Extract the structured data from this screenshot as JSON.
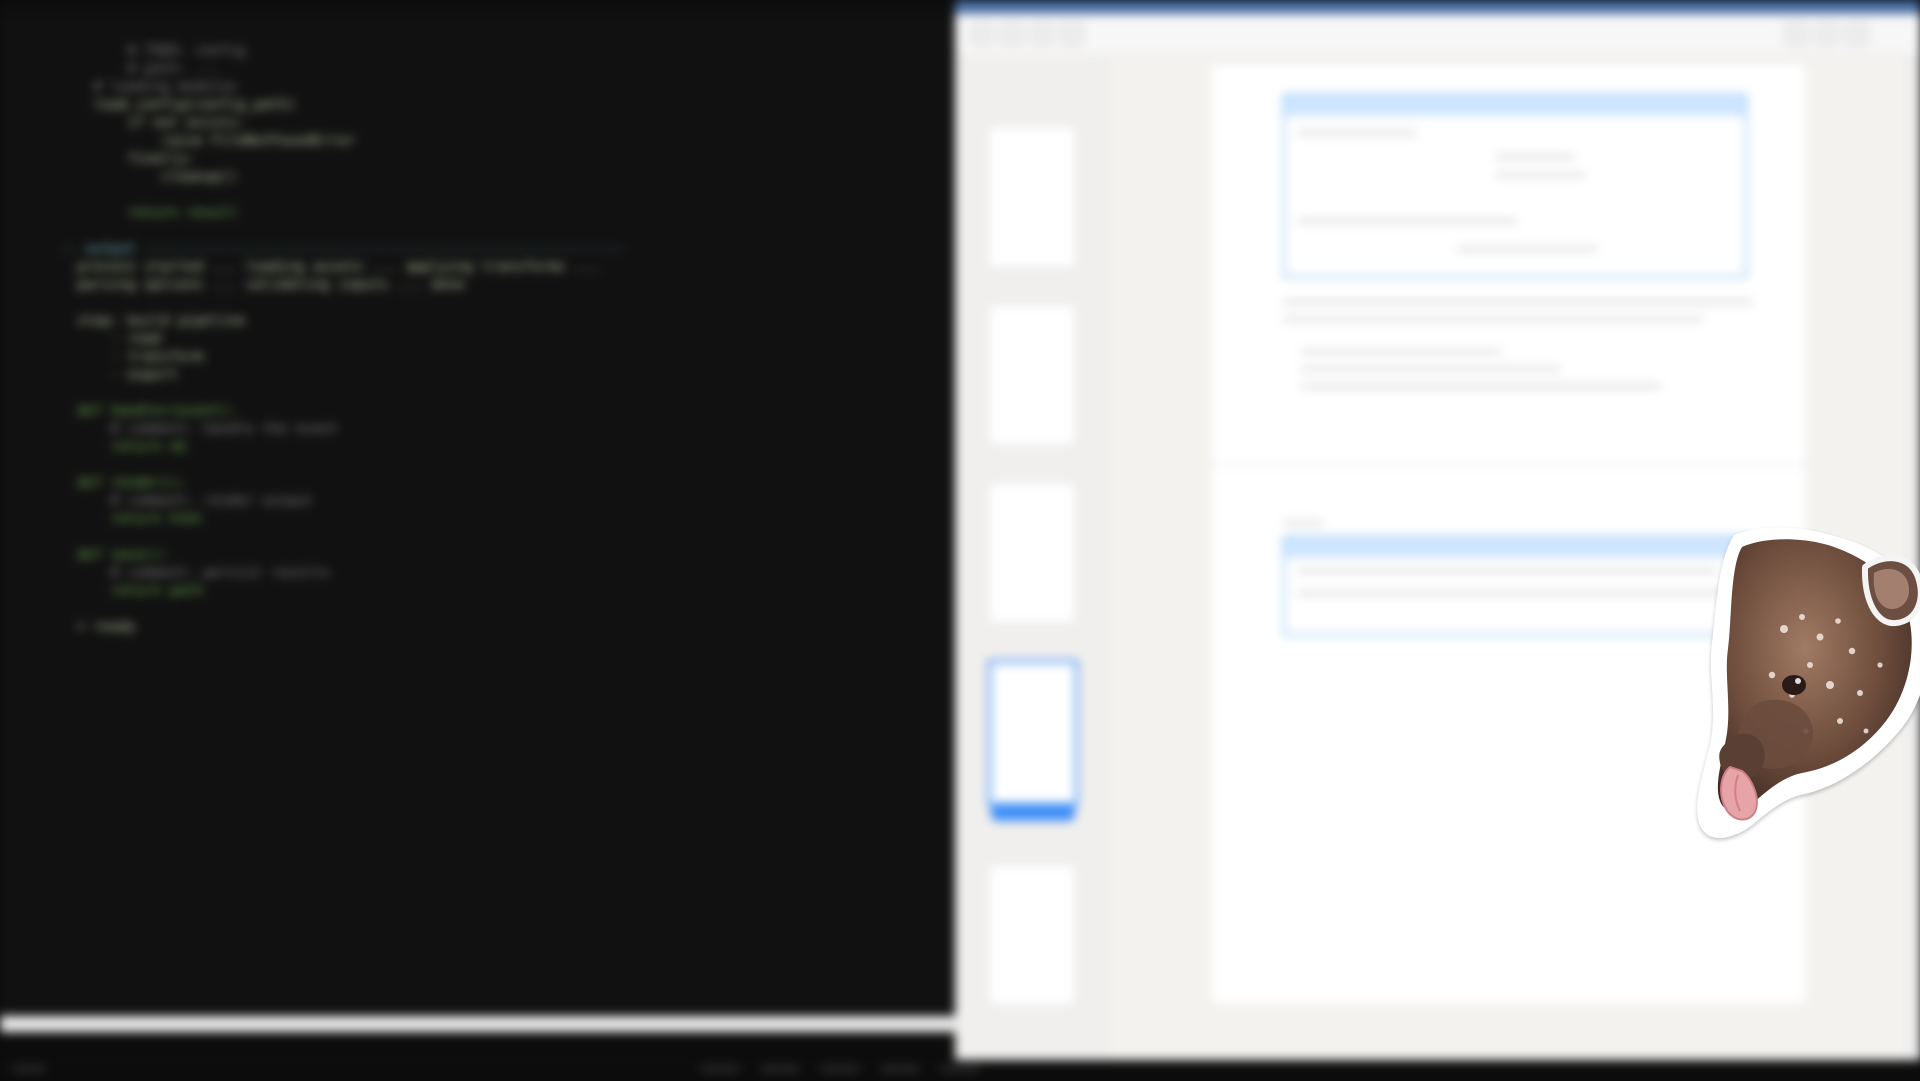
{
  "terminal": {
    "lines": [
      "        # TODO: config",
      "        # path: ...",
      "    # loading modules",
      "    load_config(config_path)",
      "        if not exists:",
      "            raise FileNotFoundError",
      "        finally:",
      "            cleanup()",
      "",
      "        return result",
      "",
      "-- output ---------------------------------------------------------",
      "  process started ... loading assets ... applying transforms ...",
      "  parsing options ... validating inputs ... done",
      "",
      "  step: build pipeline",
      "      - read",
      "      - transform",
      "      - export",
      "",
      "  def handler(event):",
      "      # comment: handle the event",
      "      return ok",
      "",
      "  def render():",
      "      # comment: render output",
      "      return html",
      "",
      "  def save():",
      "      # comment: persist results",
      "      return path",
      "",
      "  > ready"
    ]
  },
  "viewer": {
    "title": "",
    "toolbar_buttons": [
      "back-button",
      "forward-button",
      "zoom-out-button",
      "zoom-in-button",
      "share-button",
      "sidebar-toggle-button",
      "close-button"
    ],
    "thumbnails": [
      {
        "page": 1
      },
      {
        "page": 2
      },
      {
        "page": 3
      },
      {
        "page": 4,
        "active": true
      },
      {
        "page": 5
      }
    ]
  },
  "sticker": {
    "subject": "tapir-sticker"
  },
  "taskbar": {
    "items": [
      "start-button",
      "app-1",
      "app-2",
      "app-3",
      "app-4",
      "app-5"
    ]
  }
}
